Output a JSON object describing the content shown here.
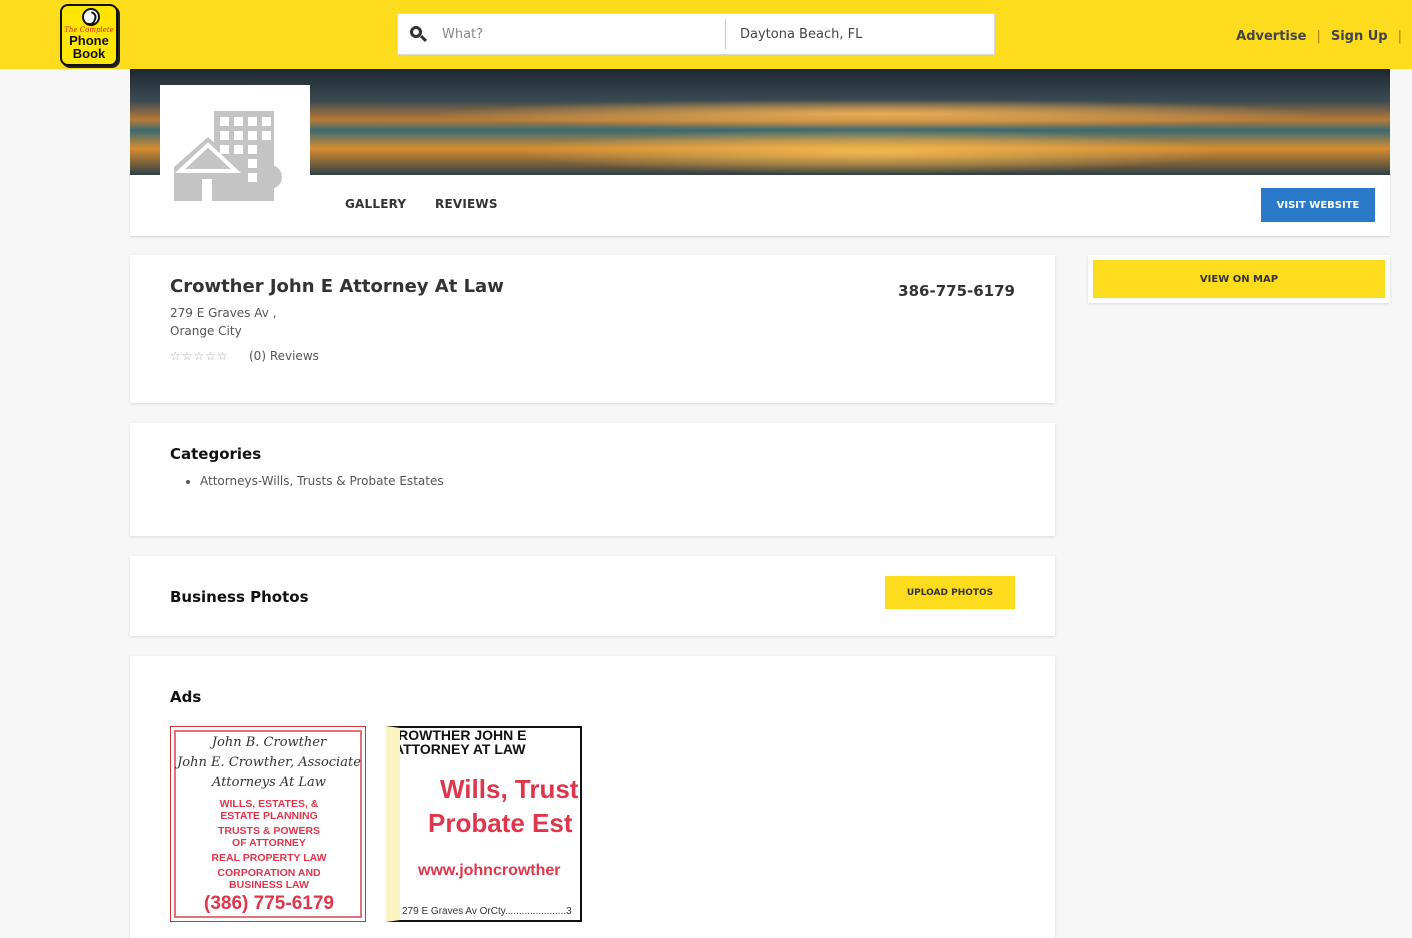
{
  "header": {
    "logo": {
      "line1": "The Complete",
      "line2": "Phone",
      "line3": "Book"
    },
    "search": {
      "what_placeholder": "What?",
      "where_value": "Daytona Beach, FL"
    },
    "nav": [
      {
        "label": "Advertise"
      },
      {
        "label": "Sign Up"
      }
    ]
  },
  "profile": {
    "tabs": [
      {
        "label": "GALLERY"
      },
      {
        "label": "REVIEWS"
      }
    ],
    "visit_website": "VISIT WEBSITE"
  },
  "business": {
    "name": "Crowther John E Attorney At Law",
    "address_line1": "279 E Graves Av ,",
    "address_line2": "Orange City",
    "rating": 0,
    "rating_max": 5,
    "reviews_label": "(0) Reviews",
    "phone": "386-775-6179"
  },
  "categories": {
    "title": "Categories",
    "items": [
      "Attorneys-Wills, Trusts & Probate Estates"
    ]
  },
  "photos": {
    "title": "Business Photos",
    "upload_label": "UPLOAD PHOTOS"
  },
  "map": {
    "label": "VIEW ON MAP"
  },
  "ads": {
    "title": "Ads",
    "ad1": {
      "script_lines": [
        "John B. Crowther",
        "John E. Crowther, Associate",
        "Attorneys At Law"
      ],
      "red_lines": [
        "WILLS, ESTATES, &",
        "ESTATE PLANNING",
        "TRUSTS & POWERS",
        "OF ATTORNEY",
        "REAL PROPERTY LAW",
        "CORPORATION AND",
        "BUSINESS LAW"
      ],
      "phone": "(386) 775-6179"
    },
    "ad2": {
      "heading_line1": "CROWTHER JOHN E",
      "heading_line2": "ATTORNEY AT LAW",
      "big_line1": "Wills, Trust",
      "big_line2": "Probate Est",
      "url": "www.johncrowther",
      "footer": "279 E Graves Av OrCty......................3"
    }
  },
  "colors": {
    "brand_yellow": "#fddc1e",
    "button_blue": "#2b79c9",
    "ad_red": "#e0364c"
  }
}
